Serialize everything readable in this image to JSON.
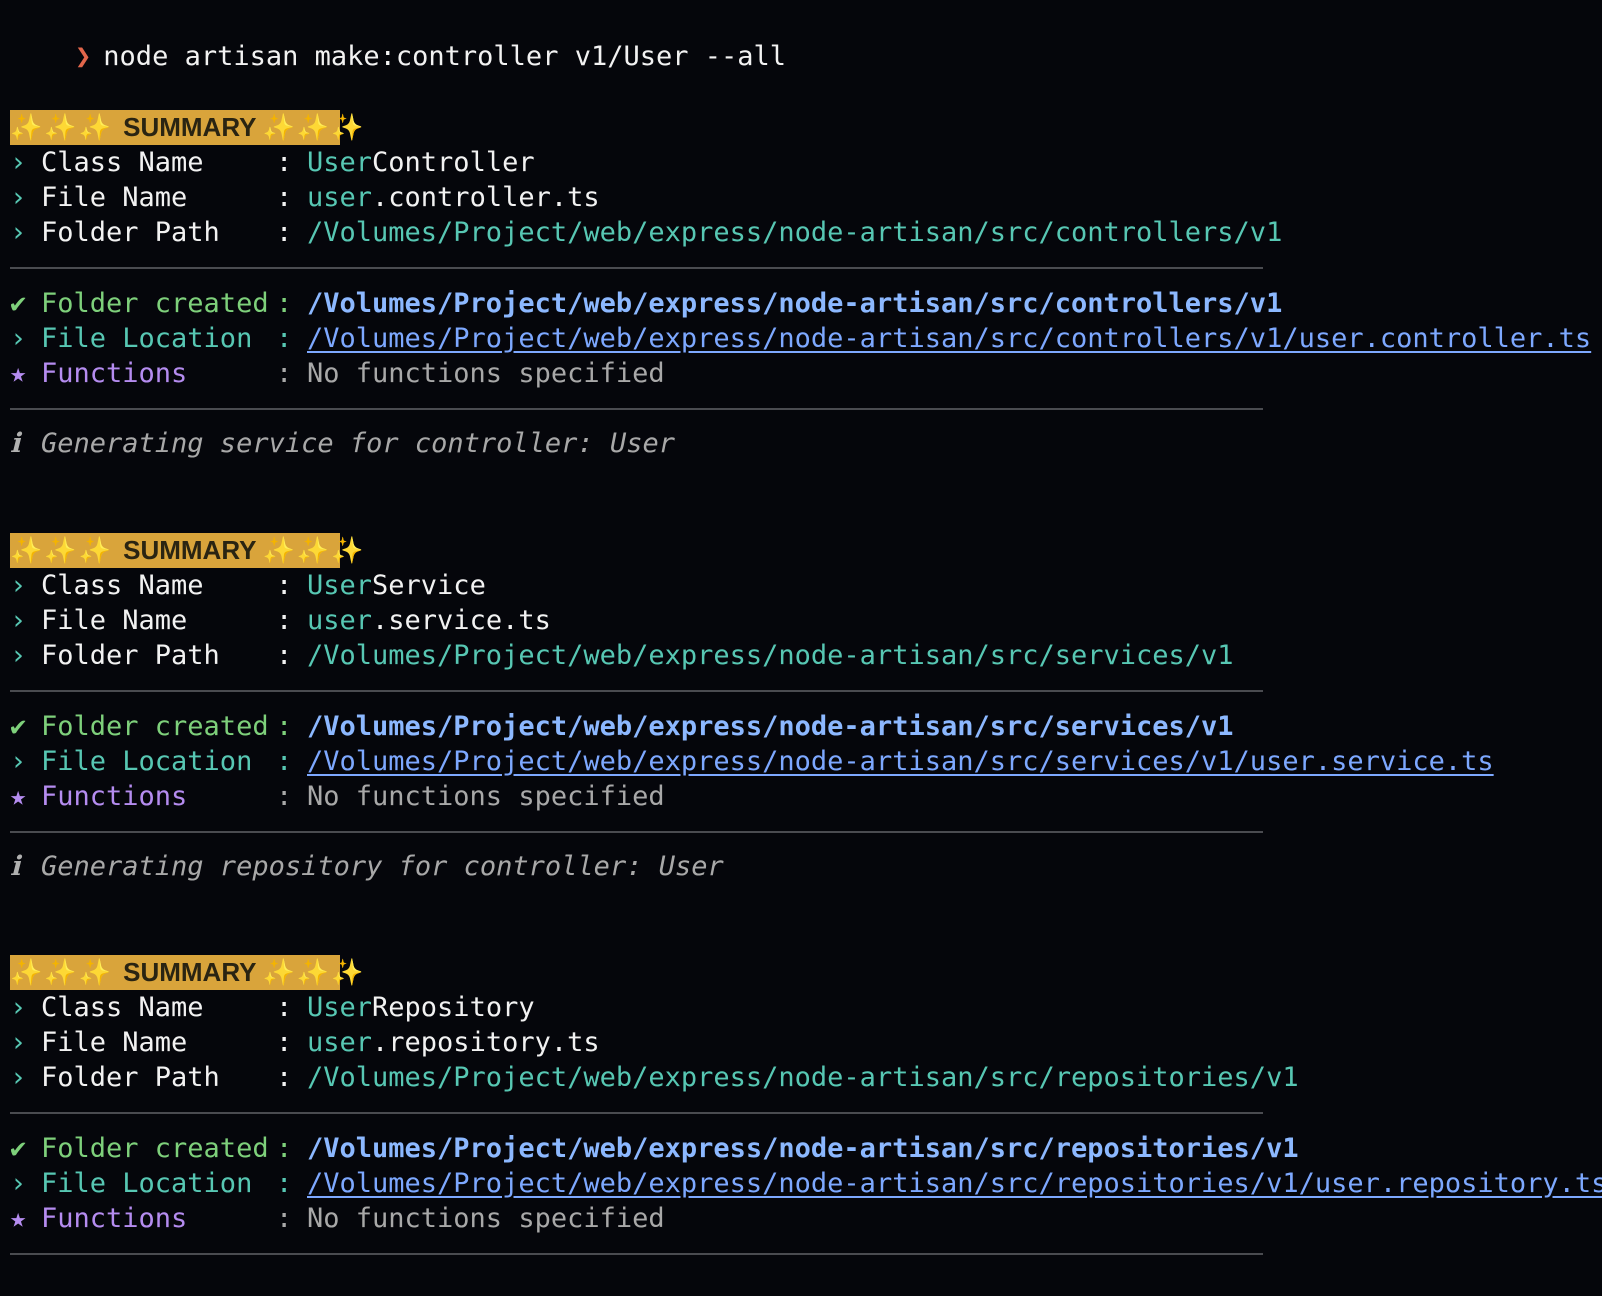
{
  "prompt": {
    "symbol": "❯",
    "command": "node artisan make:controller v1/User --all"
  },
  "labels": {
    "summary": "SUMMARY",
    "sparkles": "✨✨✨",
    "class_name": "Class Name",
    "file_name": "File Name",
    "folder_path": "Folder Path",
    "folder_created": "Folder created",
    "file_location": "File Location",
    "functions": "Functions",
    "colon": ":"
  },
  "symbols": {
    "chevron": "›",
    "check": "✔",
    "star": "★",
    "info": "ℹ"
  },
  "colors": {
    "background": "#05060b",
    "summary_badge": "#d9a43b",
    "cyan": "#57c7b3",
    "green": "#7ed07b",
    "purple": "#b58cf0",
    "link_blue": "#7da8ff",
    "prompt_arrow": "#e2664b"
  },
  "blocks": [
    {
      "class_prefix": "User",
      "class_suffix": "Controller",
      "file_prefix": "user",
      "file_suffix": ".controller.ts",
      "folder_path": "/Volumes/Project/web/express/node-artisan/src/controllers/v1",
      "folder_created": "/Volumes/Project/web/express/node-artisan/src/controllers/v1",
      "file_location": "/Volumes/Project/web/express/node-artisan/src/controllers/v1/user.controller.ts",
      "functions": "No functions specified",
      "info": "Generating service for controller: User"
    },
    {
      "class_prefix": "User",
      "class_suffix": "Service",
      "file_prefix": "user",
      "file_suffix": ".service.ts",
      "folder_path": "/Volumes/Project/web/express/node-artisan/src/services/v1",
      "folder_created": "/Volumes/Project/web/express/node-artisan/src/services/v1",
      "file_location": "/Volumes/Project/web/express/node-artisan/src/services/v1/user.service.ts",
      "functions": "No functions specified",
      "info": "Generating repository for controller: User"
    },
    {
      "class_prefix": "User",
      "class_suffix": "Repository",
      "file_prefix": "user",
      "file_suffix": ".repository.ts",
      "folder_path": "/Volumes/Project/web/express/node-artisan/src/repositories/v1",
      "folder_created": "/Volumes/Project/web/express/node-artisan/src/repositories/v1",
      "file_location": "/Volumes/Project/web/express/node-artisan/src/repositories/v1/user.repository.ts",
      "functions": "No functions specified"
    }
  ]
}
